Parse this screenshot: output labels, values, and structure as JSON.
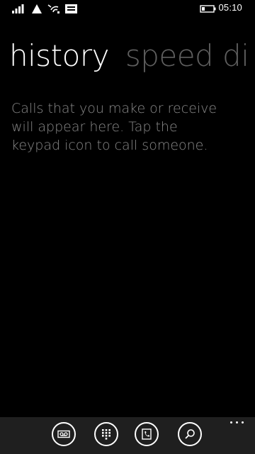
{
  "status_bar": {
    "time": "05:10",
    "icons": [
      "signal-strength-icon",
      "data-connection-icon",
      "wifi-icon",
      "message-icon",
      "battery-icon"
    ]
  },
  "pivot": {
    "items": [
      {
        "label": "history",
        "active": true
      },
      {
        "label": "speed di",
        "active": false
      }
    ]
  },
  "history": {
    "empty_message_lines": [
      "Calls that you make or receive",
      "will appear here. Tap the",
      "keypad icon to call someone."
    ]
  },
  "app_bar": {
    "buttons": [
      "voicemail-icon",
      "keypad-icon",
      "people-icon",
      "search-icon"
    ],
    "more_icon": "ellipsis-icon"
  },
  "colors": {
    "background": "#000000",
    "app_bar": "#1f1f1f",
    "active_text": "#ffffff",
    "inactive_text": "#5f5f5f",
    "message_text": "#8a8a8a"
  }
}
